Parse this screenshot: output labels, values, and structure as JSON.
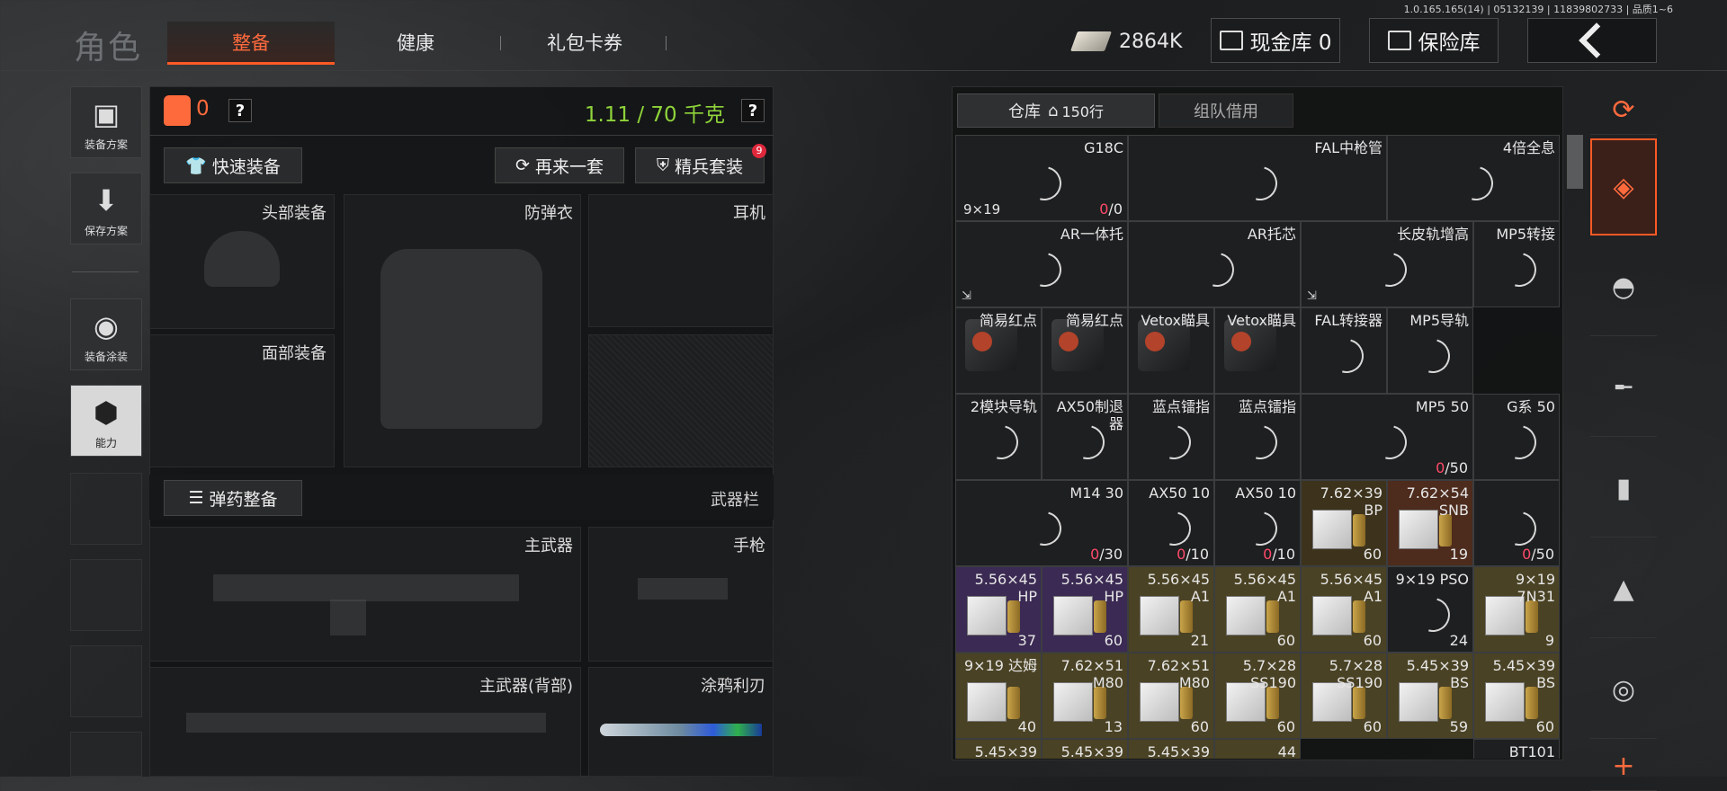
{
  "version": "1.0.165.165(14) | 05132139 | 11839802733 | 品质1~6",
  "header": {
    "title": "角色",
    "tabs": [
      {
        "label": "整备",
        "active": true
      },
      {
        "label": "健康",
        "active": false
      },
      {
        "label": "礼包卡券",
        "active": false
      }
    ],
    "currency": "2864K",
    "cash_vault": "现金库 0",
    "safe": "保险库"
  },
  "left_nav": [
    {
      "label": "装备方案",
      "icon": "vest-icon"
    },
    {
      "label": "保存方案",
      "icon": "download-icon"
    },
    {
      "label": "装备涂装",
      "icon": "helmet-paint-icon"
    },
    {
      "label": "能力",
      "icon": "ability-icon",
      "active": true
    }
  ],
  "equip": {
    "armor_count": "0",
    "weight": "1.11 / 70 千克",
    "quick_equip": "快速装备",
    "again": "再来一套",
    "elite": "精兵套装",
    "elite_badge": "9",
    "slots": {
      "head": "头部装备",
      "vest": "防弹衣",
      "ear": "耳机",
      "face": "面部装备"
    },
    "ammo_equip": "弹药整备",
    "weapon_bar": "武器栏",
    "weapons": {
      "primary": "主武器",
      "pistol": "手枪",
      "primary_back": "主武器(背部)",
      "knife": "涂鸦利刃"
    }
  },
  "warehouse": {
    "tab_main": "仓库",
    "rows": "150行",
    "tab_team": "组队借用",
    "items": [
      {
        "name": "G18C",
        "cal": "9×19",
        "count_red": "0",
        "count": "/0",
        "kind": "plain"
      },
      {
        "name": "FAL中枪管",
        "kind": "plain"
      },
      {
        "name": "4倍全息",
        "kind": "plain"
      },
      {
        "name": "AR一体托",
        "kind": "plain"
      },
      {
        "name": "AR托芯",
        "kind": "plain"
      },
      {
        "name": "长皮轨增高",
        "kind": "plain"
      },
      {
        "name": "MP5转接",
        "kind": "plain"
      },
      {
        "name": "简易红点",
        "kind": "sight"
      },
      {
        "name": "简易红点",
        "kind": "sight"
      },
      {
        "name": "Vetox瞄具",
        "kind": "sight"
      },
      {
        "name": "Vetox瞄具",
        "kind": "sight"
      },
      {
        "name": "FAL转接器",
        "kind": "plain"
      },
      {
        "name": "MP5导轨",
        "kind": "plain"
      },
      {
        "name": "2模块导轨",
        "kind": "plain"
      },
      {
        "name": "AX50制退器",
        "kind": "plain"
      },
      {
        "name": "蓝点镭指",
        "kind": "plain"
      },
      {
        "name": "蓝点镭指",
        "kind": "plain"
      },
      {
        "name": "MP5 50",
        "count_red": "0",
        "count": "/50",
        "kind": "plain"
      },
      {
        "name": "G系 50",
        "kind": "plain"
      },
      {
        "name": "M14 30",
        "count_red": "0",
        "count": "/30",
        "kind": "plain"
      },
      {
        "name": "AX50 10",
        "count_red": "0",
        "count": "/10",
        "kind": "plain"
      },
      {
        "name": "AX50 10",
        "count_red": "0",
        "count": "/10",
        "kind": "plain"
      },
      {
        "name": "7.62×39 BP",
        "count": "60",
        "kind": "brown"
      },
      {
        "name": "7.62×54 SNB",
        "count": "19",
        "kind": "orange"
      },
      {
        "name": "",
        "count_red": "0",
        "count": "/50",
        "kind": "plain"
      },
      {
        "name": "5.56×45 HP",
        "count": "37",
        "kind": "purple"
      },
      {
        "name": "5.56×45 HP",
        "count": "60",
        "kind": "purple"
      },
      {
        "name": "5.56×45 A1",
        "count": "21",
        "kind": "gold"
      },
      {
        "name": "5.56×45 A1",
        "count": "60",
        "kind": "gold"
      },
      {
        "name": "5.56×45 A1",
        "count": "60",
        "kind": "gold"
      },
      {
        "name": "9×19 PSO",
        "count": "24",
        "kind": "plain"
      },
      {
        "name": "9×19 7N31",
        "count": "9",
        "kind": "gold"
      },
      {
        "name": "9×19 达姆",
        "count": "40",
        "kind": "gold"
      },
      {
        "name": "7.62×51 M80",
        "count": "13",
        "kind": "gold"
      },
      {
        "name": "7.62×51 M80",
        "count": "60",
        "kind": "gold"
      },
      {
        "name": "5.7×28 SS190",
        "count": "60",
        "kind": "gold"
      },
      {
        "name": "5.7×28 SS190",
        "count": "60",
        "kind": "gold"
      },
      {
        "name": "5.45×39 BS",
        "count": "59",
        "kind": "gold"
      },
      {
        "name": "5.45×39 BS",
        "count": "60",
        "kind": "gold"
      },
      {
        "name": "5.45×39",
        "kind": "gold"
      },
      {
        "name": "5.45×39",
        "kind": "gold"
      },
      {
        "name": "5.45×39",
        "kind": "gold"
      },
      {
        "name": "44",
        "kind": "gold"
      },
      {
        "name": "BT101",
        "kind": "plain"
      }
    ]
  },
  "right_rail": [
    {
      "icon": "stack-refresh-icon"
    },
    {
      "icon": "layers-icon",
      "active": true
    },
    {
      "icon": "helmet-icon"
    },
    {
      "icon": "rifle-icon"
    },
    {
      "icon": "magazine-icon"
    },
    {
      "icon": "bullet-icon"
    },
    {
      "icon": "scope-icon"
    },
    {
      "icon": "plus-icon"
    }
  ]
}
